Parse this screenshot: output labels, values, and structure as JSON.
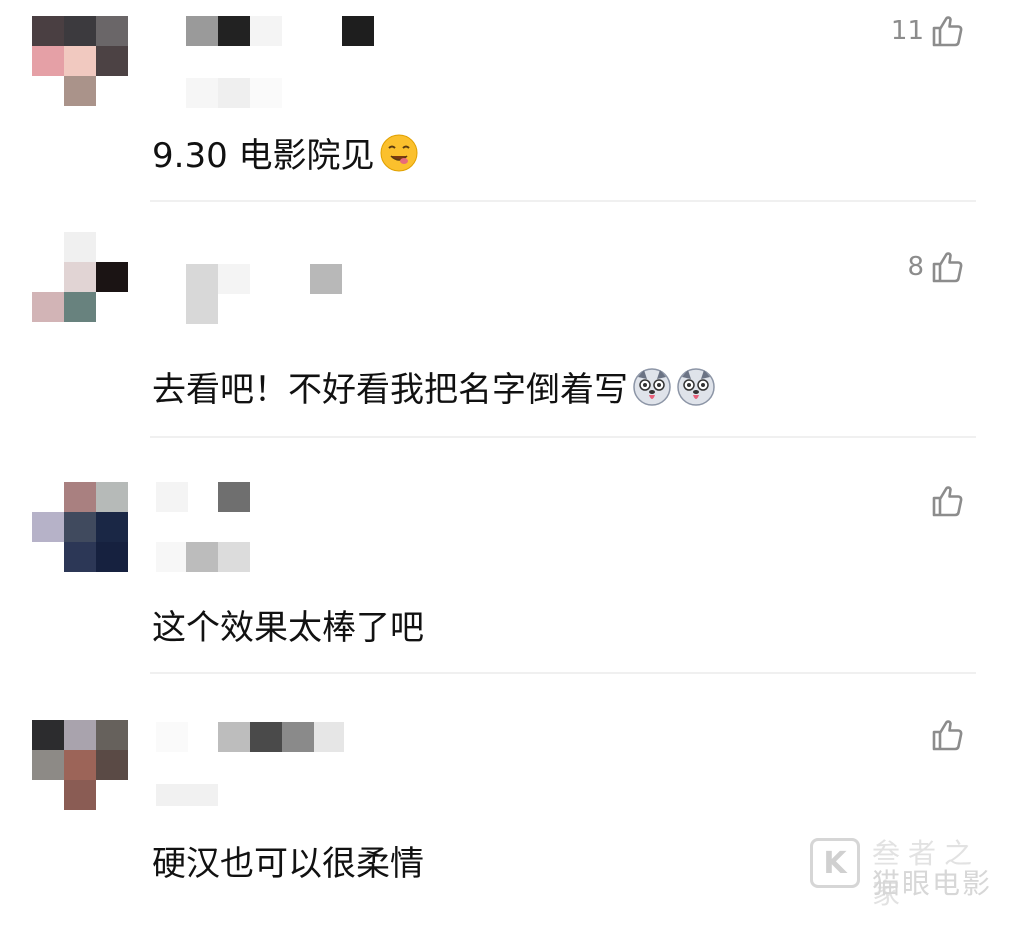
{
  "comments": [
    {
      "likes": "11",
      "text": "9.30 电影院见",
      "emojis": [
        "drooling-face-emoji"
      ],
      "avatar_colors": [
        "#4a3f42",
        "#3c3a3e",
        "#6a6668",
        "#e5a0a6",
        "#f1c9c0",
        "#4c4244",
        "#ffffff",
        "#aa938a",
        "#ffffff"
      ],
      "name_colors": [
        "#9a9a9a",
        "#222222",
        "#f4f4f4",
        "#ffffff",
        "#1e1e1e"
      ],
      "sub_colors": [
        "#f6f6f6",
        "#efefef",
        "#fafafa"
      ]
    },
    {
      "likes": "8",
      "text": "去看吧！不好看我把名字倒着写",
      "emojis": [
        "husky-emoji",
        "husky-emoji"
      ],
      "avatar_colors": [
        "#ffffff",
        "#f0f0f0",
        "#ffffff",
        "#ffffff",
        "#e1d4d4",
        "#1b1414",
        "#d2b4b6",
        "#68827e",
        "#ffffff"
      ],
      "name_colors": [
        "#d8d8d8",
        "#f4f4f4",
        "#ffffff",
        "#b8b8b8"
      ],
      "sub_colors": [
        "#d6d6d6",
        "#fafafa"
      ]
    },
    {
      "likes": "",
      "text": "这个效果太棒了吧",
      "emojis": [],
      "avatar_colors": [
        "#ffffff",
        "#a98080",
        "#b6bab8",
        "#b6b2c8",
        "#404a5e",
        "#1a2745",
        "#ffffff",
        "#2c3756",
        "#16213f"
      ],
      "name_colors": [
        "#f4f4f4",
        "#ffffff",
        "#6f6f6f"
      ],
      "sub_colors": [
        "#f7f7f7",
        "#bcbcbc",
        "#dcdcdc"
      ]
    },
    {
      "likes": "",
      "text": "硬汉也可以很柔情",
      "emojis": [],
      "avatar_colors": [
        "#2c2c2e",
        "#a9a3ad",
        "#66615c",
        "#8d8a86",
        "#9c6458",
        "#5a4a45",
        "#ffffff",
        "#8a5c54",
        "#ffffff"
      ],
      "name_colors": [
        "#fafafa",
        "#bdbdbd",
        "#4a4a4a",
        "#8a8a8a",
        "#e6e6e6"
      ],
      "sub_colors": [
        "#f1f1f1",
        "#f6f6f6"
      ]
    }
  ],
  "icons": {
    "like": "thumbs-up-outline-icon"
  },
  "watermark": {
    "logo": "K",
    "top": "叁者之家",
    "bottom": "猫眼电影"
  }
}
